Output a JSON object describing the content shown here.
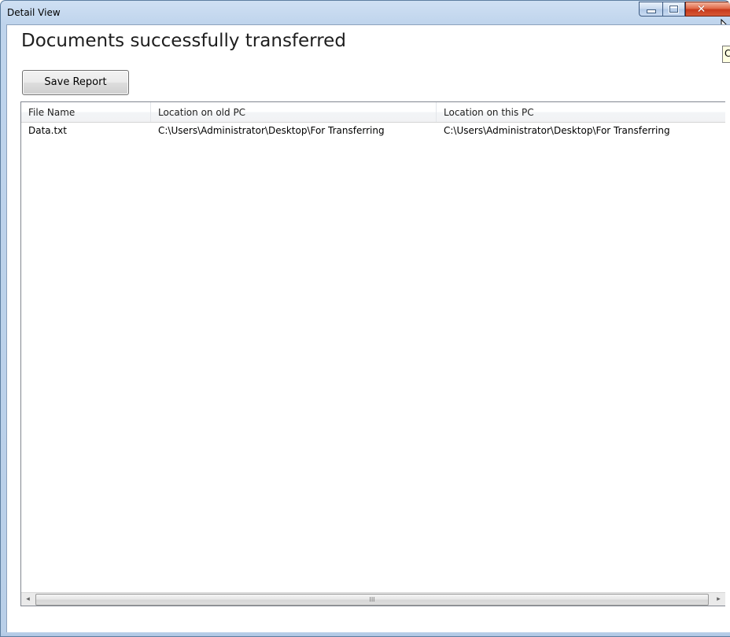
{
  "window": {
    "title": "Detail View",
    "buttons": {
      "minimize_icon": "minimize-icon",
      "maximize_icon": "maximize-icon",
      "close_icon": "close-icon",
      "close_glyph": "✕"
    },
    "tooltip_partial": "C"
  },
  "main": {
    "heading": "Documents successfully transferred",
    "save_report_label": "Save Report"
  },
  "table": {
    "columns": [
      "File Name",
      "Location on old PC",
      "Location on this PC"
    ],
    "rows": [
      [
        "Data.txt",
        "C:\\Users\\Administrator\\Desktop\\For Transferring",
        "C:\\Users\\Administrator\\Desktop\\For Transferring"
      ]
    ]
  },
  "scrollbar": {
    "left_arrow": "◂",
    "right_arrow": "▸",
    "thumb_grip": "III"
  },
  "colors": {
    "title_bar": "#bfd4ec",
    "close_button": "#c7391b",
    "content_background": "#ffffff"
  }
}
